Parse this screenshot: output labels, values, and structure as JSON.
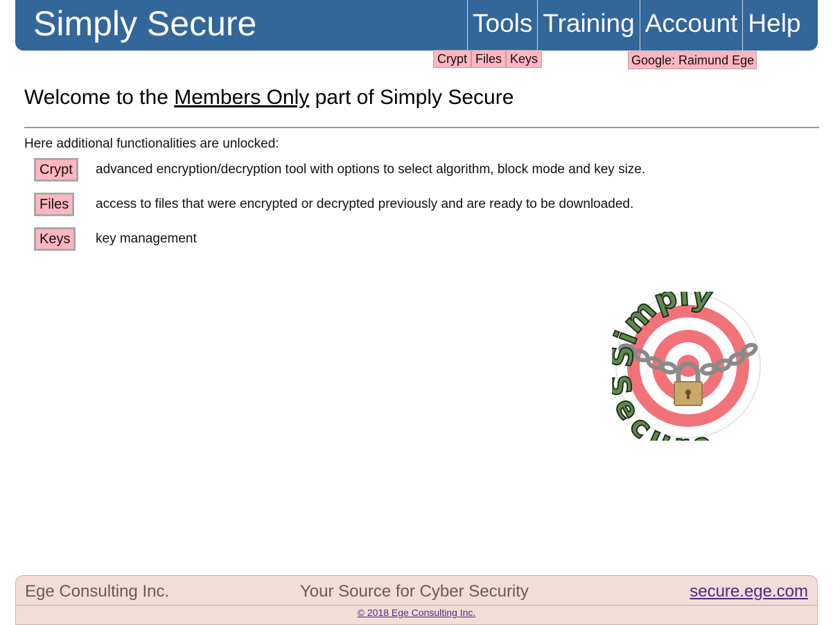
{
  "header": {
    "brand": "Simply Secure",
    "nav": [
      "Tools",
      "Training",
      "Account",
      "Help"
    ]
  },
  "tools_menu": [
    "Crypt",
    "Files",
    "Keys"
  ],
  "account_badge": "Google: Raimund Ege",
  "main": {
    "title_pre": "Welcome to the ",
    "title_link": "Members Only",
    "title_post": " part of Simply Secure",
    "intro": "Here additional functionalities are unlocked:",
    "features": [
      {
        "label": "Crypt",
        "desc": "advanced encryption/decryption tool with options to select algorithm, block mode and key size."
      },
      {
        "label": "Files",
        "desc": "access to files that were encrypted or decrypted previously and are ready to be downloaded."
      },
      {
        "label": "Keys",
        "desc": "key management"
      }
    ]
  },
  "logo": {
    "top_text": "Simply",
    "bottom_text": "Secure",
    "icon": "padlock-target-logo"
  },
  "footer": {
    "company": "Ege Consulting Inc.",
    "tagline": "Your Source for Cyber Security",
    "site": "secure.ege.com",
    "copyright": "© 2018 Ege Consulting Inc."
  },
  "colors": {
    "header_bg": "#336699",
    "button_bg": "#ffb6c1",
    "footer_bg": "#f4ddd6"
  }
}
